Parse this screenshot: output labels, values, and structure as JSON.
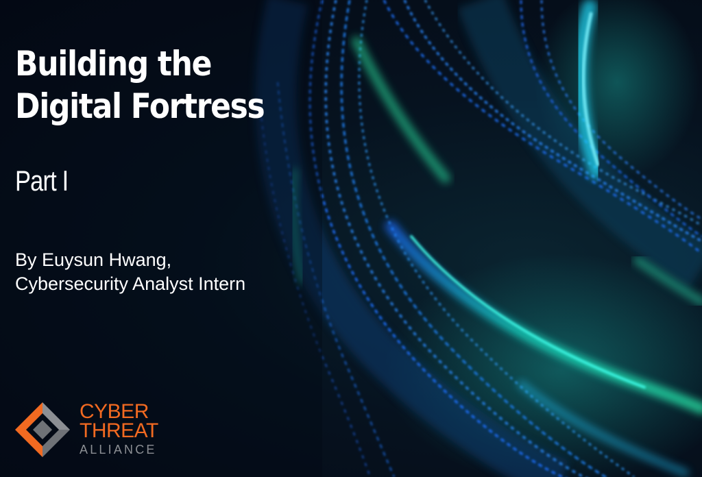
{
  "hero": {
    "title_line1": "Building the",
    "title_line2": "Digital Fortress",
    "subtitle": "Part I",
    "byline_line1": "By Euysun Hwang,",
    "byline_line2": "Cybersecurity Analyst Intern"
  },
  "logo": {
    "line1": "CYBER",
    "line2": "THREAT",
    "line3": "ALLIANCE",
    "icon": "diamond-logo-icon"
  },
  "colors": {
    "background": "#050a16",
    "text": "#ffffff",
    "brand_orange": "#f26a21",
    "brand_gray": "#8c8f94",
    "accent_cyan": "#22e3d6",
    "accent_blue": "#1e78ff"
  }
}
